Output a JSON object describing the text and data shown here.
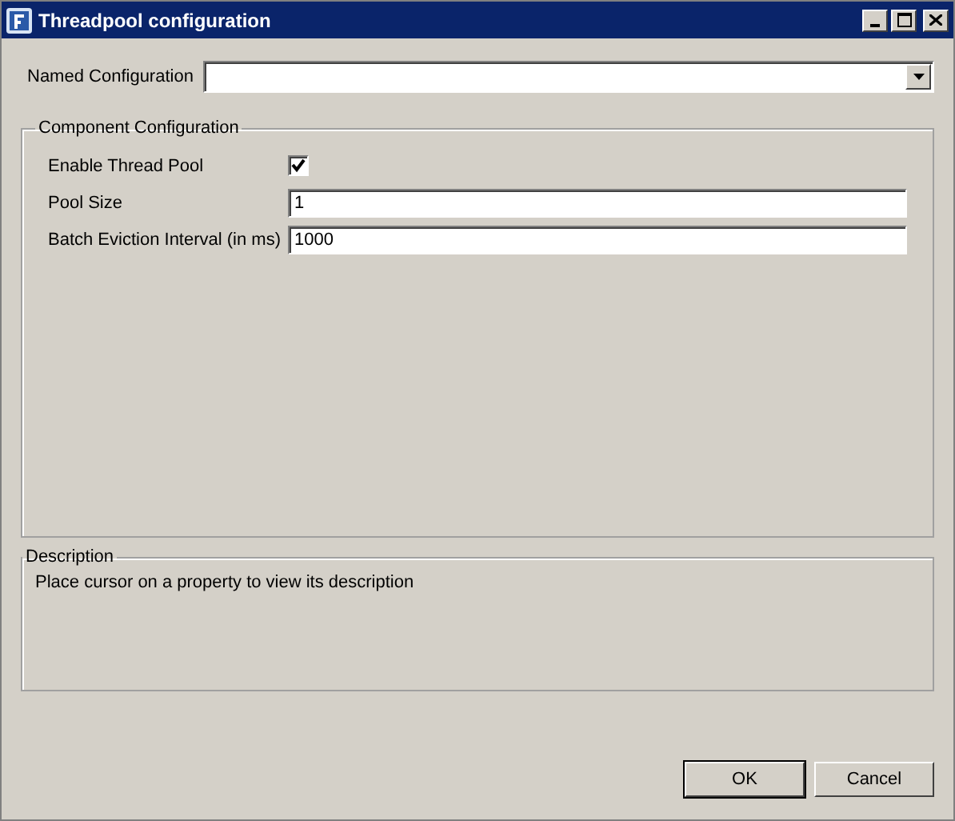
{
  "window": {
    "title": "Threadpool configuration"
  },
  "named_configuration": {
    "label": "Named Configuration"
  },
  "component_configuration": {
    "title": "Component Configuration",
    "properties": [
      {
        "kind": "checkbox",
        "label": "Enable Thread Pool",
        "checked": true
      },
      {
        "kind": "text",
        "label": "Pool Size",
        "value": "1"
      },
      {
        "kind": "text",
        "label": "Batch Eviction Interval (in ms)",
        "value": "1000"
      }
    ]
  },
  "description": {
    "title": "Description",
    "text": "Place cursor on a property to view its description"
  },
  "buttons": [
    {
      "label": "OK",
      "default": true
    },
    {
      "label": "Cancel",
      "default": false
    }
  ]
}
